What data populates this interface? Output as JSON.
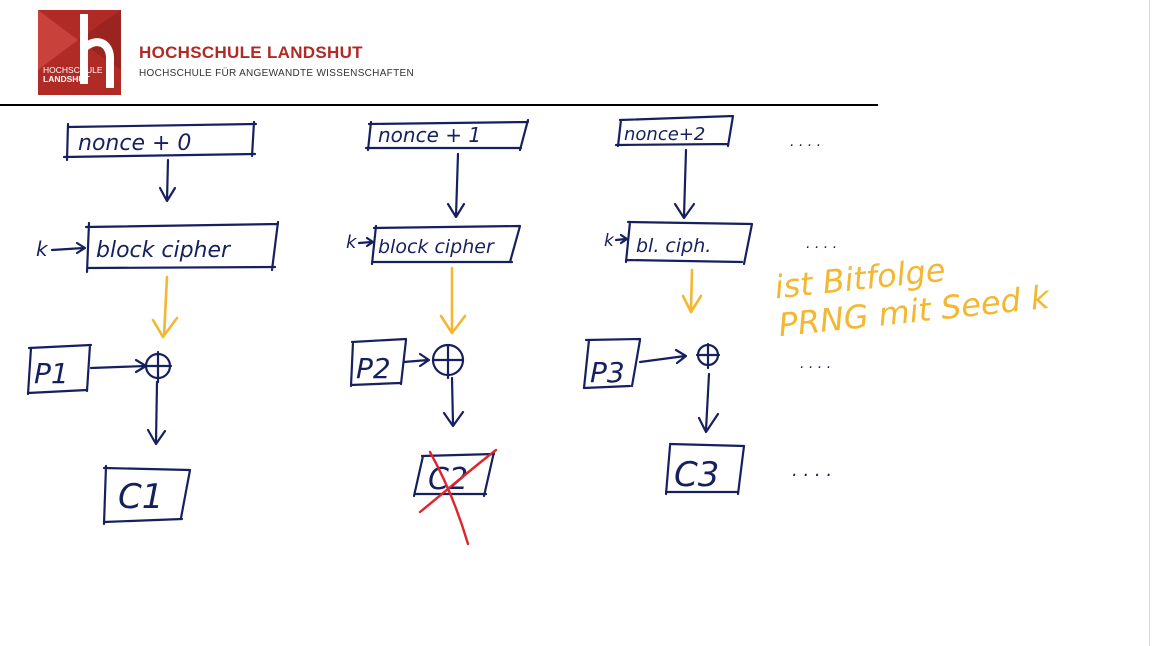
{
  "header": {
    "logo_text_1": "HOCHSCHULE",
    "logo_text_2": "LANDSHUT",
    "name": "HOCHSCHULE LANDSHUT",
    "subtitle": "HOCHSCHULE FÜR ANGEWANDTE WISSENSCHAFTEN"
  },
  "colors": {
    "brand_red": "#b02a26",
    "ink_blue": "#17205e",
    "ink_yellow": "#f3b731",
    "ink_red": "#e0242d"
  },
  "diagram": {
    "nonce_labels": [
      "nonce + 0",
      "nonce + 1",
      "nonce+2"
    ],
    "key_labels": [
      "k",
      "k",
      "k"
    ],
    "cipher_labels": [
      "block cipher",
      "block cipher",
      "bl. ciph."
    ],
    "plaintext_labels": [
      "P1",
      "P2",
      "P3"
    ],
    "ciphertext_labels": [
      "C1",
      "C2",
      "C3"
    ],
    "xor_symbol": "⊕",
    "arrow_symbol": "→",
    "ellipsis": ". . . .",
    "annotation_line_1": "ist Bitfolge",
    "annotation_line_2": "PRNG mit Seed k"
  }
}
